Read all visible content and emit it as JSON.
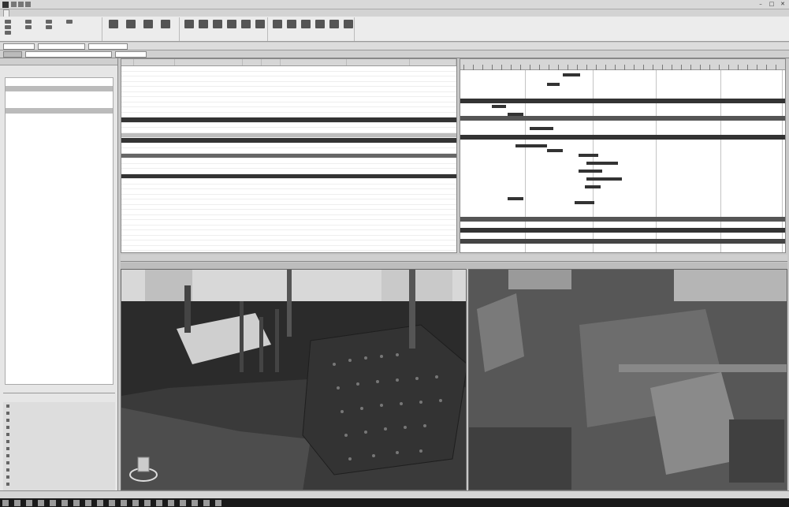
{
  "window": {
    "title": "",
    "controls": [
      "–",
      "□",
      "✕"
    ]
  },
  "ribbon": {
    "tabs": [
      "",
      "",
      "",
      "",
      ""
    ]
  },
  "grid": {
    "columns": [
      "",
      "",
      "",
      "",
      "",
      "",
      "",
      ""
    ]
  },
  "viewports": {
    "left_label": "",
    "right_label": ""
  },
  "icons": {
    "app": "app-icon",
    "minimize": "minimize-icon",
    "maximize": "maximize-icon",
    "close": "close-icon",
    "nav_cube": "navigation-cube-icon"
  },
  "colors": {
    "dark_row": "#333333",
    "mid_row": "#666666",
    "bar": "#333333",
    "viewport_bg": "#2a2a2a"
  }
}
